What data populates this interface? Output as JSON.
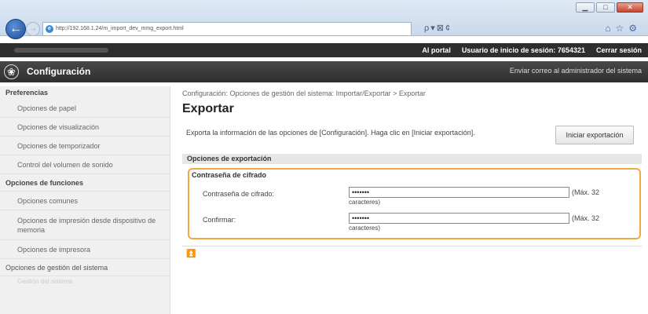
{
  "browser": {
    "url": "http://192.168.1.24/m_import_dev_mmg_export.html",
    "ie_icon": "ie-icon",
    "search_tools": "ρ▾⊠¢",
    "right_tools": "⌂☆⚙",
    "window_buttons": {
      "minimize": "▁",
      "maximize": "□",
      "close": "✕"
    }
  },
  "topbar": {
    "portal": "Al portal",
    "user_label": "Usuario de inicio de sesión:",
    "user_id": "7654321",
    "logout": "Cerrar sesión"
  },
  "titlebar": {
    "title": "Configuración",
    "mail": "Enviar correo al administrador del sistema"
  },
  "sidebar": {
    "preferences_header": "Preferencias",
    "items": [
      "Opciones de papel",
      "Opciones de visualización",
      "Opciones de temporizador",
      "Control del volumen de sonido"
    ],
    "functions_header": "Opciones de funciones",
    "function_items": [
      "Opciones comunes",
      "Opciones de impresión desde dispositivo de memoria",
      "Opciones de impresora"
    ],
    "system_group": "Opciones de gestión del sistema",
    "faded_item": "Gestión del sistema"
  },
  "main": {
    "breadcrumb": "Configuración: Opciones de gestión del sistema: Importar/Exportar > Exportar",
    "title": "Exportar",
    "description": "Exporta la información de las opciones de [Configuración]. Haga clic en [Iniciar exportación].",
    "start_button": "Iniciar exportación",
    "section_title": "Opciones de exportación",
    "panel_title": "Contraseña de cifrado",
    "password_label": "Contraseña de cifrado:",
    "password_value": "•••••••",
    "confirm_label": "Confirmar:",
    "confirm_value": "•••••••",
    "max_hint_1": "(Máx. 32",
    "max_hint_2": "caracteres)",
    "scroll_top_icon": "⏫"
  },
  "colors": {
    "highlight": "#f3a646",
    "topbar": "#2e2e2e",
    "titlebar": "#3c3c3c"
  }
}
